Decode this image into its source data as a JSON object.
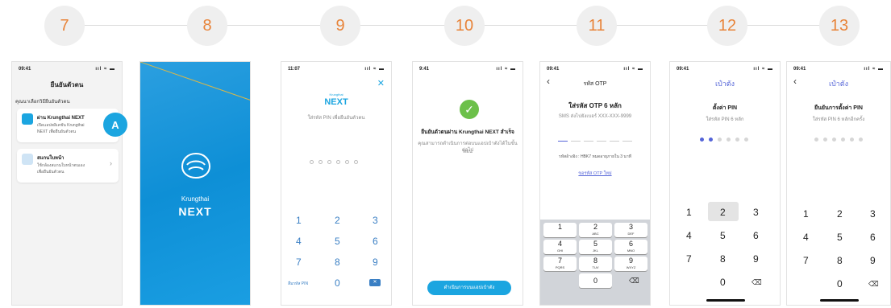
{
  "steps": [
    "7",
    "8",
    "9",
    "10",
    "11",
    "12",
    "13"
  ],
  "s7": {
    "time": "09:41",
    "title": "ยืนยันตัวตน",
    "subtitle": "คุณนาเลือกวิธียืนยันตัวตน",
    "card1": {
      "title": "ผ่าน Krungthai NEXT",
      "d1": "เปิดแอปพลิเคชัน Krungthai",
      "d2": "NEXT เพื่อยืนยันตัวตน"
    },
    "card2": {
      "title": "สแกนใบหน้า",
      "d1": "ใช้กล้องสแกนใบหน้าตนเอง",
      "d2": "เพื่อยืนยันตัวตน"
    },
    "badge": "A"
  },
  "s8": {
    "brand_line1": "Krungthai",
    "brand_line2": "NEXT"
  },
  "s9": {
    "time": "11:07",
    "logo_small": "Krungthai",
    "logo": "NEXT",
    "hint": "ใส่รหัส PIN เพื่อยืนยันตัวตน",
    "keys": [
      "1",
      "2",
      "3",
      "4",
      "5",
      "6",
      "7",
      "8",
      "9"
    ],
    "forgot": "ลืมรหัส PIN",
    "zero": "0"
  },
  "s10": {
    "time": "9:41",
    "title": "ยืนยันตัวตนผ่าน Krungthai NEXT สำเร็จ",
    "desc1": "คุณสามารถดำเนินการต่อบนแอปเป๋าตังได้ในขั้นตอน",
    "desc2": "ต่อไป",
    "button": "ดำเนินการบนแอปเป๋าตัง"
  },
  "s11": {
    "time": "09:41",
    "header": "รหัส OTP",
    "title": "ใส่รหัส OTP 6 หลัก",
    "sms": "SMS ส่งไปยังเบอร์ XXX-XXX-9999",
    "ref": "รหัสอ้างอิง : HBK7  หมดอายุภายใน 3 นาที",
    "resend": "ขอรหัส OTP ใหม่",
    "keys": [
      {
        "n": "1",
        "s": ""
      },
      {
        "n": "2",
        "s": "ABC"
      },
      {
        "n": "3",
        "s": "DEF"
      },
      {
        "n": "4",
        "s": "GHI"
      },
      {
        "n": "5",
        "s": "JKL"
      },
      {
        "n": "6",
        "s": "MNO"
      },
      {
        "n": "7",
        "s": "PQRS"
      },
      {
        "n": "8",
        "s": "TUV"
      },
      {
        "n": "9",
        "s": "WXYZ"
      }
    ],
    "zero": "0"
  },
  "s12": {
    "time": "09:41",
    "header": "เป๋าตัง",
    "title": "ตั้งค่า PIN",
    "hint": "ใส่รหัส PIN 6 หลัก",
    "filled": 2,
    "keys": [
      "1",
      "2",
      "3",
      "4",
      "5",
      "6",
      "7",
      "8",
      "9"
    ],
    "zero": "0"
  },
  "s13": {
    "time": "09:41",
    "header": "เป๋าตัง",
    "title": "ยืนยันการตั้งค่า PIN",
    "hint": "ใส่รหัส PIN 6 หลักอีกครั้ง",
    "keys": [
      "1",
      "2",
      "3",
      "4",
      "5",
      "6",
      "7",
      "8",
      "9"
    ],
    "zero": "0"
  }
}
